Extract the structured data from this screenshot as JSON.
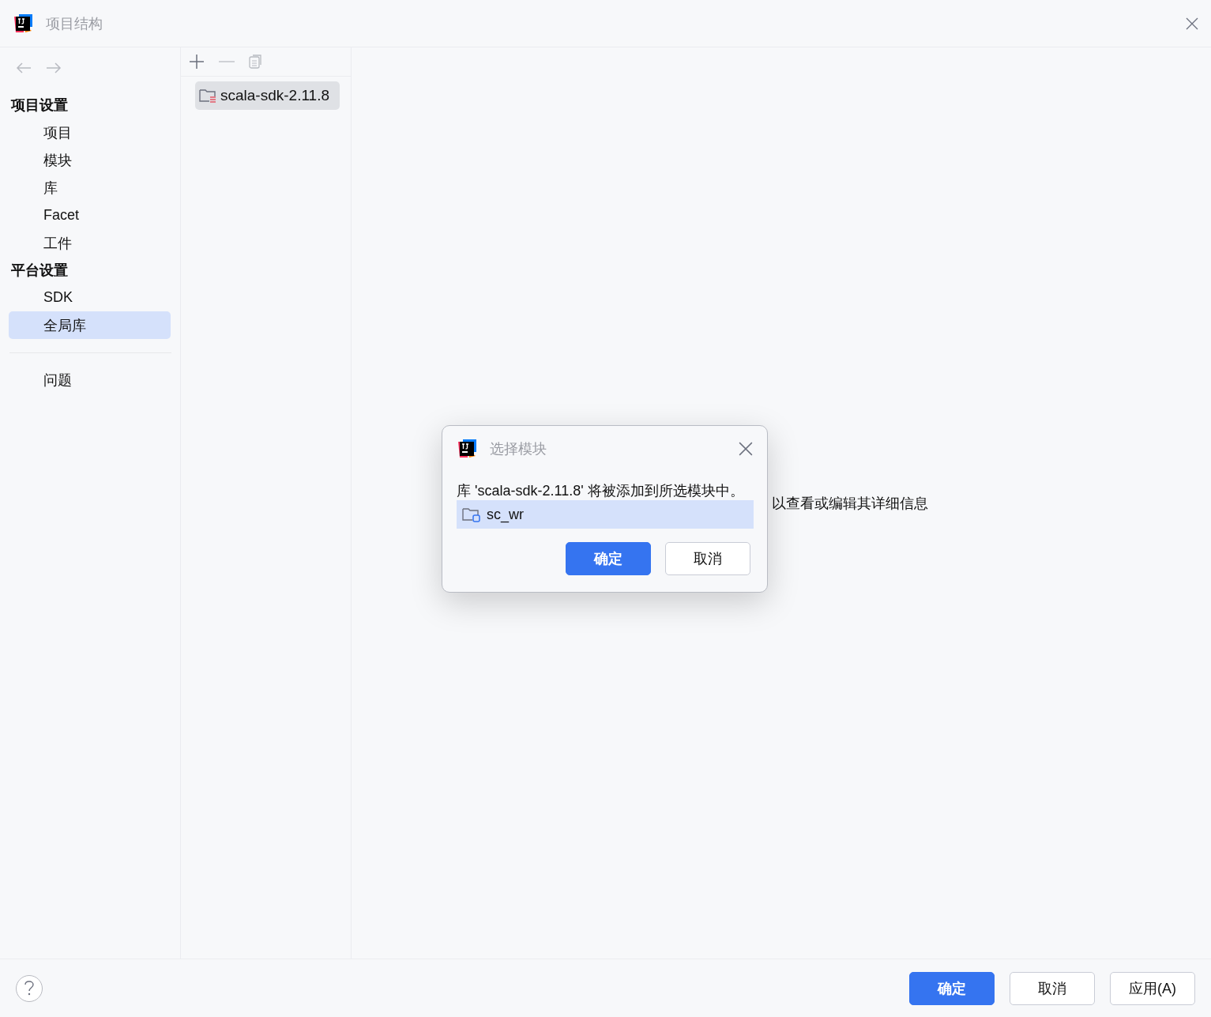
{
  "window": {
    "title": "项目结构"
  },
  "sidebar": {
    "sections": [
      {
        "heading": "项目设置",
        "items": [
          {
            "label": "项目",
            "selected": false
          },
          {
            "label": "模块",
            "selected": false
          },
          {
            "label": "库",
            "selected": false
          },
          {
            "label": "Facet",
            "selected": false
          },
          {
            "label": "工件",
            "selected": false
          }
        ]
      },
      {
        "heading": "平台设置",
        "items": [
          {
            "label": "SDK",
            "selected": false
          },
          {
            "label": "全局库",
            "selected": true
          }
        ]
      }
    ],
    "bottom_items": [
      {
        "label": "问题",
        "selected": false
      }
    ]
  },
  "libraries": {
    "items": [
      {
        "label": "scala-sdk-2.11.8",
        "selected": true
      }
    ]
  },
  "details": {
    "hint": "以查看或编辑其详细信息"
  },
  "dialog": {
    "title": "选择模块",
    "message": "库 'scala-sdk-2.11.8' 将被添加到所选模块中。",
    "modules": [
      {
        "label": "sc_wr",
        "selected": true
      }
    ],
    "buttons": [
      {
        "label": "确定",
        "kind": "primary"
      },
      {
        "label": "取消",
        "kind": "secondary"
      }
    ]
  },
  "footer": {
    "buttons": [
      {
        "label": "确定",
        "kind": "primary"
      },
      {
        "label": "取消",
        "kind": "secondary"
      },
      {
        "label": "应用(A)",
        "kind": "secondary"
      }
    ]
  }
}
